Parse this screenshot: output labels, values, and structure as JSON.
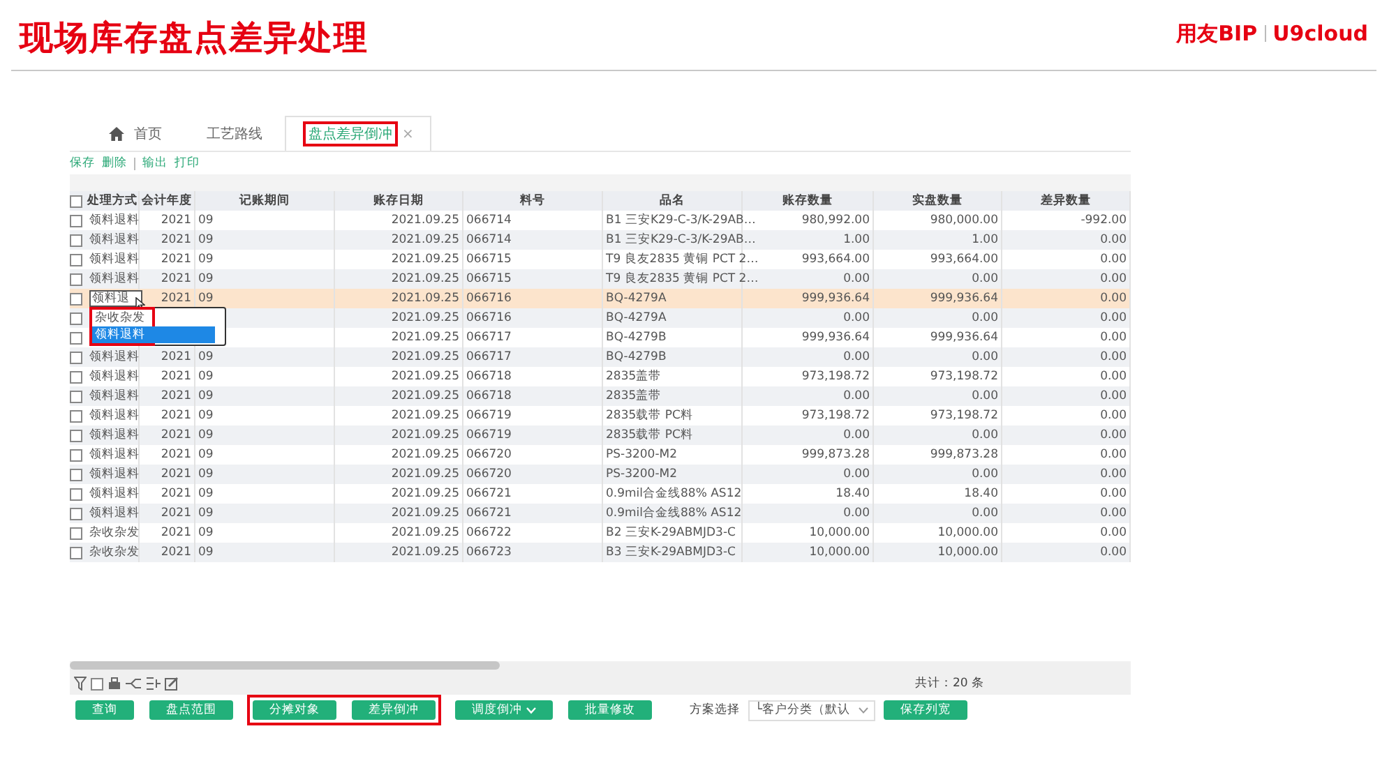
{
  "slide": {
    "title": "现场库存盘点差异处理",
    "logo": {
      "brand": "用友BIP",
      "product": "U9cloud"
    }
  },
  "tabs": [
    {
      "label": "首页",
      "selected": false,
      "highlighted": false
    },
    {
      "label": "工艺路线",
      "selected": false,
      "highlighted": false
    },
    {
      "label": "盘点差异倒冲",
      "selected": true,
      "close": "×",
      "highlighted": true
    }
  ],
  "toolbar": [
    "保存",
    "删除",
    "输出",
    "打印"
  ],
  "table": {
    "all_checked": false,
    "columns": [
      "处理方式",
      "会计年度",
      "记账期间",
      "账存日期",
      "料号",
      "品名",
      "账存数量",
      "实盘数量",
      "差异数量"
    ],
    "rows": [
      {
        "selected": false,
        "checked": false,
        "cells": [
          "领料退料",
          "2021",
          "09",
          "2021.09.25",
          "066714",
          "B1 三安K29-C-3/K-29AB…",
          "980,992.00",
          "980,000.00",
          "-992.00"
        ]
      },
      {
        "selected": false,
        "checked": false,
        "cells": [
          "领料退料",
          "2021",
          "09",
          "2021.09.25",
          "066714",
          "B1 三安K29-C-3/K-29AB…",
          "1.00",
          "1.00",
          "0.00"
        ]
      },
      {
        "selected": false,
        "checked": false,
        "cells": [
          "领料退料",
          "2021",
          "09",
          "2021.09.25",
          "066715",
          "T9 良友2835 黄铜 PCT 2…",
          "993,664.00",
          "993,664.00",
          "0.00"
        ]
      },
      {
        "selected": false,
        "checked": false,
        "cells": [
          "领料退料",
          "2021",
          "09",
          "2021.09.25",
          "066715",
          "T9 良友2835 黄铜 PCT 2…",
          "0.00",
          "0.00",
          "0.00"
        ]
      },
      {
        "selected": true,
        "checked": false,
        "editor": {
          "value": "领料退",
          "options": [
            {
              "label": "杂收杂发",
              "selected": false
            },
            {
              "label": "领料退料",
              "selected": true
            }
          ],
          "highlighted": true
        },
        "cells": [
          null,
          "2021",
          "09",
          "2021.09.25",
          "066716",
          "BQ-4279A",
          "999,936.64",
          "999,936.64",
          "0.00"
        ]
      },
      {
        "selected": false,
        "checked": false,
        "cells": [
          null,
          null,
          null,
          "2021.09.25",
          "066716",
          "BQ-4279A",
          "0.00",
          "0.00",
          "0.00"
        ]
      },
      {
        "selected": false,
        "checked": false,
        "cells": [
          null,
          null,
          null,
          "2021.09.25",
          "066717",
          "BQ-4279B",
          "999,936.64",
          "999,936.64",
          "0.00"
        ]
      },
      {
        "selected": false,
        "checked": false,
        "cells": [
          "领料退料",
          "2021",
          "09",
          "2021.09.25",
          "066717",
          "BQ-4279B",
          "0.00",
          "0.00",
          "0.00"
        ]
      },
      {
        "selected": false,
        "checked": false,
        "cells": [
          "领料退料",
          "2021",
          "09",
          "2021.09.25",
          "066718",
          "2835盖带",
          "973,198.72",
          "973,198.72",
          "0.00"
        ]
      },
      {
        "selected": false,
        "checked": false,
        "cells": [
          "领料退料",
          "2021",
          "09",
          "2021.09.25",
          "066718",
          "2835盖带",
          "0.00",
          "0.00",
          "0.00"
        ]
      },
      {
        "selected": false,
        "checked": false,
        "cells": [
          "领料退料",
          "2021",
          "09",
          "2021.09.25",
          "066719",
          "2835载带 PC料",
          "973,198.72",
          "973,198.72",
          "0.00"
        ]
      },
      {
        "selected": false,
        "checked": false,
        "cells": [
          "领料退料",
          "2021",
          "09",
          "2021.09.25",
          "066719",
          "2835载带 PC料",
          "0.00",
          "0.00",
          "0.00"
        ]
      },
      {
        "selected": false,
        "checked": false,
        "cells": [
          "领料退料",
          "2021",
          "09",
          "2021.09.25",
          "066720",
          "PS-3200-M2",
          "999,873.28",
          "999,873.28",
          "0.00"
        ]
      },
      {
        "selected": false,
        "checked": false,
        "cells": [
          "领料退料",
          "2021",
          "09",
          "2021.09.25",
          "066720",
          "PS-3200-M2",
          "0.00",
          "0.00",
          "0.00"
        ]
      },
      {
        "selected": false,
        "checked": false,
        "cells": [
          "领料退料",
          "2021",
          "09",
          "2021.09.25",
          "066721",
          "0.9mil合金线88% AS12",
          "18.40",
          "18.40",
          "0.00"
        ]
      },
      {
        "selected": false,
        "checked": false,
        "cells": [
          "领料退料",
          "2021",
          "09",
          "2021.09.25",
          "066721",
          "0.9mil合金线88% AS12",
          "0.00",
          "0.00",
          "0.00"
        ]
      },
      {
        "selected": false,
        "checked": false,
        "cells": [
          "杂收杂发",
          "2021",
          "09",
          "2021.09.25",
          "066722",
          "B2 三安K-29ABMJD3-C",
          "10,000.00",
          "10,000.00",
          "0.00"
        ]
      },
      {
        "selected": false,
        "checked": false,
        "cells": [
          "杂收杂发",
          "2021",
          "09",
          "2021.09.25",
          "066723",
          "B3 三安K-29ABMJD3-C",
          "10,000.00",
          "10,000.00",
          "0.00"
        ]
      }
    ]
  },
  "total": "共计：20 条",
  "icon_bar_checkbox": {
    "checked": false
  },
  "buttons": [
    {
      "label": "查询",
      "kind": "button",
      "highlighted": false
    },
    {
      "label": "盘点范围",
      "kind": "button",
      "highlighted": false
    },
    {
      "label": "分摊对象",
      "kind": "button",
      "highlighted": true
    },
    {
      "label": "差异倒冲",
      "kind": "button",
      "highlighted": true
    },
    {
      "label": "调度倒冲",
      "kind": "menu",
      "highlighted": false
    },
    {
      "label": "批量修改",
      "kind": "button",
      "highlighted": false
    }
  ],
  "scheme": {
    "label": "方案选择",
    "value": "└客户分类（默认"
  },
  "save_button": "保存列宽"
}
